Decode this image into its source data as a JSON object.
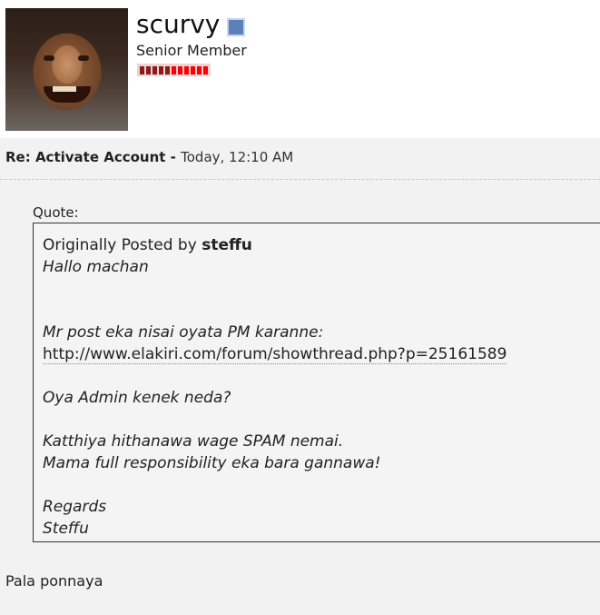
{
  "user": {
    "name": "scurvy",
    "title": "Senior Member",
    "status_icon": "offline-status-icon",
    "reputation": [
      "#8b1a1a",
      "#8b1a1a",
      "#8b1a1a",
      "#8b1a1a",
      "#8b1a1a",
      "#ff0000",
      "#ff0000",
      "#ff0000",
      "#ff0000",
      "#ff0000",
      "#ff0000"
    ]
  },
  "post": {
    "title": "Re: Activate Account",
    "separator": " - ",
    "time": "Today, 12:10 AM"
  },
  "quote": {
    "label": "Quote:",
    "originally_posted_by": "Originally Posted by ",
    "author": "steffu",
    "lines": {
      "l1": "Hallo machan",
      "l2": "Mr post eka nisai oyata PM karanne:",
      "link": "http://www.elakiri.com/forum/showthread.php?p=25161589",
      "l3": "Oya Admin kenek neda?",
      "l4": "Katthiya hithanawa wage SPAM nemai.",
      "l5": "Mama full responsibility eka bara gannawa!",
      "l6": "Regards",
      "l7": "Steffu"
    }
  },
  "reply": {
    "text": "Pala ponnaya"
  }
}
